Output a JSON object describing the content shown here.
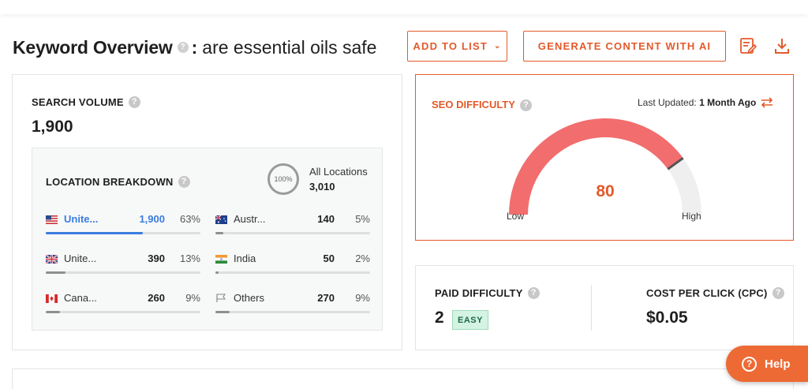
{
  "header": {
    "title": "Keyword Overview",
    "colon": ":",
    "keyword": "are essential oils safe",
    "add_to_list": "ADD TO LIST",
    "generate": "GENERATE CONTENT WITH AI"
  },
  "search_volume": {
    "label": "SEARCH VOLUME",
    "value": "1,900"
  },
  "location": {
    "label": "LOCATION BREAKDOWN",
    "all_pct": "100%",
    "all_label": "All Locations",
    "all_value": "3,010",
    "items": [
      {
        "name": "Unite...",
        "value": "1,900",
        "pct": "63%",
        "fill": 0.63
      },
      {
        "name": "Austr...",
        "value": "140",
        "pct": "5%",
        "fill": 0.05
      },
      {
        "name": "Unite...",
        "value": "390",
        "pct": "13%",
        "fill": 0.13
      },
      {
        "name": "India",
        "value": "50",
        "pct": "2%",
        "fill": 0.02
      },
      {
        "name": "Cana...",
        "value": "260",
        "pct": "9%",
        "fill": 0.09
      },
      {
        "name": "Others",
        "value": "270",
        "pct": "9%",
        "fill": 0.09
      }
    ]
  },
  "seo": {
    "label": "SEO DIFFICULTY",
    "updated_prefix": "Last Updated:",
    "updated_value": "1 Month Ago",
    "value": "80",
    "low": "Low",
    "high": "High"
  },
  "paid": {
    "label": "PAID DIFFICULTY",
    "value": "2",
    "badge": "EASY"
  },
  "cpc": {
    "label": "COST PER CLICK (CPC)",
    "value": "$0.05"
  },
  "help": {
    "label": "Help"
  },
  "colors": {
    "accent": "#e35a2b",
    "gauge": "#f26d6d",
    "active": "#3a7de0"
  }
}
